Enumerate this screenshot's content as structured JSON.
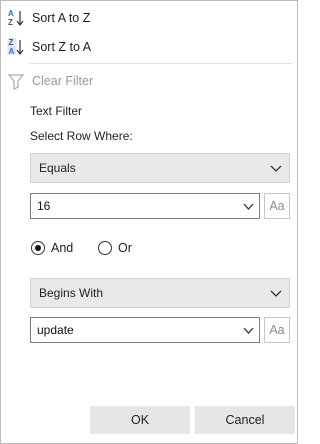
{
  "menu": {
    "sort_az": "Sort A to Z",
    "sort_za": "Sort Z to A",
    "clear_filter": "Clear Filter"
  },
  "filter": {
    "heading": "Text Filter",
    "select_row_where": "Select Row Where:",
    "condition1": {
      "operator": "Equals",
      "value": "16",
      "case_label": "Aa"
    },
    "logic": {
      "and_label": "And",
      "or_label": "Or",
      "selected": "And"
    },
    "condition2": {
      "operator": "Begins With",
      "value": "update",
      "case_label": "Aa"
    }
  },
  "buttons": {
    "ok": "OK",
    "cancel": "Cancel"
  },
  "icons": {
    "sort_az": "sort-ascending-icon",
    "sort_za": "sort-descending-icon",
    "clear_filter": "funnel-clear-icon",
    "dropdown": "chevron-down-icon"
  },
  "colors": {
    "accent_blue": "#2f6fb8",
    "disabled_text": "#9a9a9a",
    "button_bg": "#e6e6e6"
  }
}
